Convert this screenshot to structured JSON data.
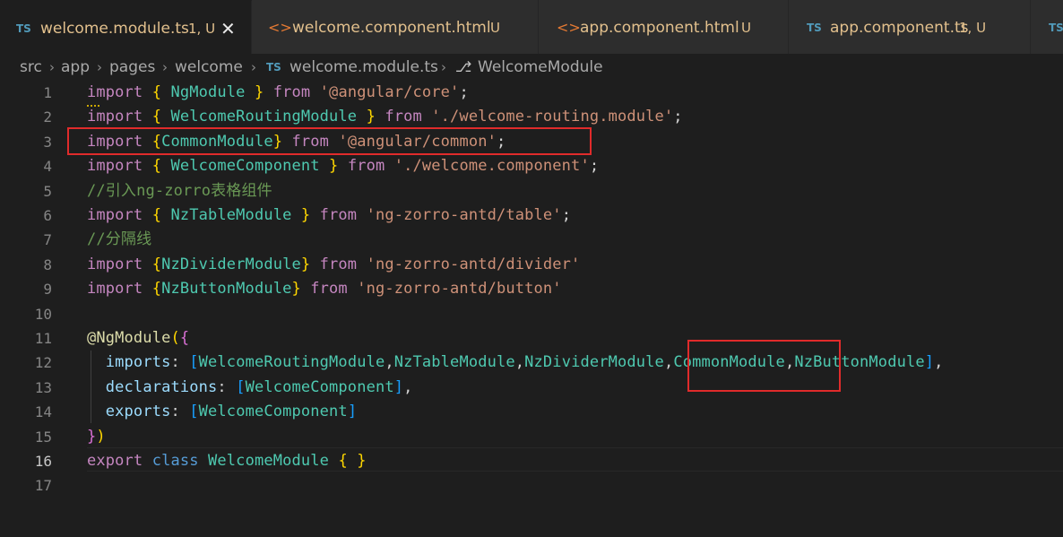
{
  "tabs": [
    {
      "icon": "TS",
      "name": "welcome.module.ts",
      "status": "1, U",
      "active": true,
      "close": "✕"
    },
    {
      "icon": "<>",
      "name": "welcome.component.html",
      "status": "U"
    },
    {
      "icon": "<>",
      "name": "app.component.html",
      "status": "U"
    },
    {
      "icon": "TS",
      "name": "app.component.ts",
      "status": "1, U"
    },
    {
      "icon": "TS",
      "name": ""
    }
  ],
  "breadcrumb": {
    "items": [
      "src",
      "app",
      "pages",
      "welcome"
    ],
    "separator": "›",
    "file_icon": "TS",
    "file": "welcome.module.ts",
    "symbol_icon": "⎇",
    "symbol": "WelcomeModule"
  },
  "editor": {
    "line_numbers": [
      "1",
      "2",
      "3",
      "4",
      "5",
      "6",
      "7",
      "8",
      "9",
      "10",
      "11",
      "12",
      "13",
      "14",
      "15",
      "16",
      "17"
    ],
    "current_line": "16",
    "lines": [
      [
        {
          "t": "import",
          "c": "kw"
        },
        {
          "t": " "
        },
        {
          "t": "{",
          "c": "b1"
        },
        {
          "t": " NgModule ",
          "c": "cls"
        },
        {
          "t": "}",
          "c": "b1"
        },
        {
          "t": " "
        },
        {
          "t": "from",
          "c": "kw"
        },
        {
          "t": " "
        },
        {
          "t": "'@angular/core'",
          "c": "str"
        },
        {
          "t": ";"
        }
      ],
      [
        {
          "t": "import",
          "c": "kw"
        },
        {
          "t": " "
        },
        {
          "t": "{",
          "c": "b1"
        },
        {
          "t": " WelcomeRoutingModule ",
          "c": "cls"
        },
        {
          "t": "}",
          "c": "b1"
        },
        {
          "t": " "
        },
        {
          "t": "from",
          "c": "kw"
        },
        {
          "t": " "
        },
        {
          "t": "'./welcome-routing.module'",
          "c": "str"
        },
        {
          "t": ";"
        }
      ],
      [
        {
          "t": "import",
          "c": "kw"
        },
        {
          "t": " "
        },
        {
          "t": "{",
          "c": "b1"
        },
        {
          "t": "CommonModule",
          "c": "cls"
        },
        {
          "t": "}",
          "c": "b1"
        },
        {
          "t": " "
        },
        {
          "t": "from",
          "c": "kw"
        },
        {
          "t": " "
        },
        {
          "t": "'@angular/common'",
          "c": "str"
        },
        {
          "t": ";"
        }
      ],
      [
        {
          "t": "import",
          "c": "kw"
        },
        {
          "t": " "
        },
        {
          "t": "{",
          "c": "b1"
        },
        {
          "t": " WelcomeComponent ",
          "c": "cls"
        },
        {
          "t": "}",
          "c": "b1"
        },
        {
          "t": " "
        },
        {
          "t": "from",
          "c": "kw"
        },
        {
          "t": " "
        },
        {
          "t": "'./welcome.component'",
          "c": "str"
        },
        {
          "t": ";"
        }
      ],
      [
        {
          "t": "//引入ng-zorro表格组件",
          "c": "cmt"
        }
      ],
      [
        {
          "t": "import",
          "c": "kw"
        },
        {
          "t": " "
        },
        {
          "t": "{",
          "c": "b1"
        },
        {
          "t": " NzTableModule ",
          "c": "cls"
        },
        {
          "t": "}",
          "c": "b1"
        },
        {
          "t": " "
        },
        {
          "t": "from",
          "c": "kw"
        },
        {
          "t": " "
        },
        {
          "t": "'ng-zorro-antd/table'",
          "c": "str"
        },
        {
          "t": ";"
        }
      ],
      [
        {
          "t": "//分隔线",
          "c": "cmt"
        }
      ],
      [
        {
          "t": "import",
          "c": "kw"
        },
        {
          "t": " "
        },
        {
          "t": "{",
          "c": "b1"
        },
        {
          "t": "NzDividerModule",
          "c": "cls"
        },
        {
          "t": "}",
          "c": "b1"
        },
        {
          "t": " "
        },
        {
          "t": "from",
          "c": "kw"
        },
        {
          "t": " "
        },
        {
          "t": "'ng-zorro-antd/divider'",
          "c": "str"
        }
      ],
      [
        {
          "t": "import",
          "c": "kw"
        },
        {
          "t": " "
        },
        {
          "t": "{",
          "c": "b1"
        },
        {
          "t": "NzButtonModule",
          "c": "cls"
        },
        {
          "t": "}",
          "c": "b1"
        },
        {
          "t": " "
        },
        {
          "t": "from",
          "c": "kw"
        },
        {
          "t": " "
        },
        {
          "t": "'ng-zorro-antd/button'",
          "c": "str"
        }
      ],
      [],
      [
        {
          "t": "@NgModule",
          "c": "dec"
        },
        {
          "t": "(",
          "c": "b1"
        },
        {
          "t": "{",
          "c": "b2"
        }
      ],
      [
        {
          "t": "  "
        },
        {
          "t": "imports",
          "c": "prop"
        },
        {
          "t": ": "
        },
        {
          "t": "[",
          "c": "b3"
        },
        {
          "t": "WelcomeRoutingModule",
          "c": "cls"
        },
        {
          "t": ","
        },
        {
          "t": "NzTableModule",
          "c": "cls"
        },
        {
          "t": ","
        },
        {
          "t": "NzDividerModule",
          "c": "cls"
        },
        {
          "t": ","
        },
        {
          "t": "CommonModule",
          "c": "cls"
        },
        {
          "t": ","
        },
        {
          "t": "NzButtonModule",
          "c": "cls"
        },
        {
          "t": "]",
          "c": "b3"
        },
        {
          "t": ","
        }
      ],
      [
        {
          "t": "  "
        },
        {
          "t": "declarations",
          "c": "prop"
        },
        {
          "t": ": "
        },
        {
          "t": "[",
          "c": "b3"
        },
        {
          "t": "WelcomeComponent",
          "c": "cls"
        },
        {
          "t": "]",
          "c": "b3"
        },
        {
          "t": ","
        }
      ],
      [
        {
          "t": "  "
        },
        {
          "t": "exports",
          "c": "prop"
        },
        {
          "t": ": "
        },
        {
          "t": "[",
          "c": "b3"
        },
        {
          "t": "WelcomeComponent",
          "c": "cls"
        },
        {
          "t": "]",
          "c": "b3"
        }
      ],
      [
        {
          "t": "}",
          "c": "b2"
        },
        {
          "t": ")",
          "c": "b1"
        }
      ],
      [
        {
          "t": "export",
          "c": "kw"
        },
        {
          "t": " "
        },
        {
          "t": "class",
          "c": "kw2"
        },
        {
          "t": " "
        },
        {
          "t": "WelcomeModule",
          "c": "cls"
        },
        {
          "t": " "
        },
        {
          "t": "{",
          "c": "b1"
        },
        {
          "t": " "
        },
        {
          "t": "}",
          "c": "b1"
        }
      ],
      []
    ]
  }
}
